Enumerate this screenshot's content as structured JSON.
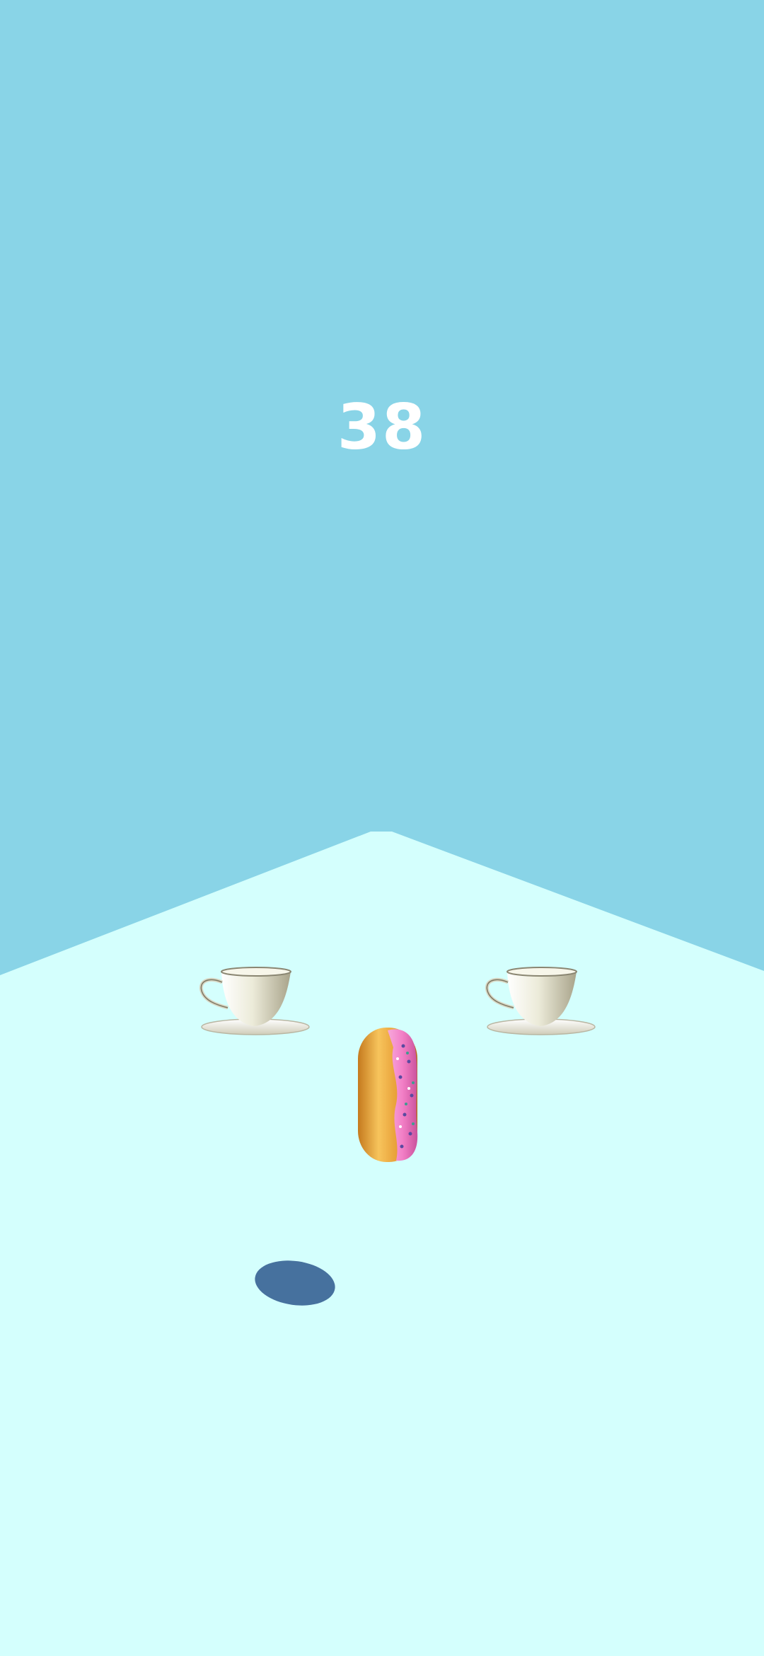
{
  "game": {
    "score": "38"
  },
  "colors": {
    "sky": "#89d4e7",
    "table": "#d4fffd",
    "shadow": "#46719e",
    "cup": "#ecebd9",
    "donut_dough": "#e9a43c",
    "donut_icing": "#f27fc6"
  },
  "objects": {
    "cups": [
      "teacup-left",
      "teacup-right"
    ],
    "player": "donut",
    "shadow": "donut-shadow"
  }
}
